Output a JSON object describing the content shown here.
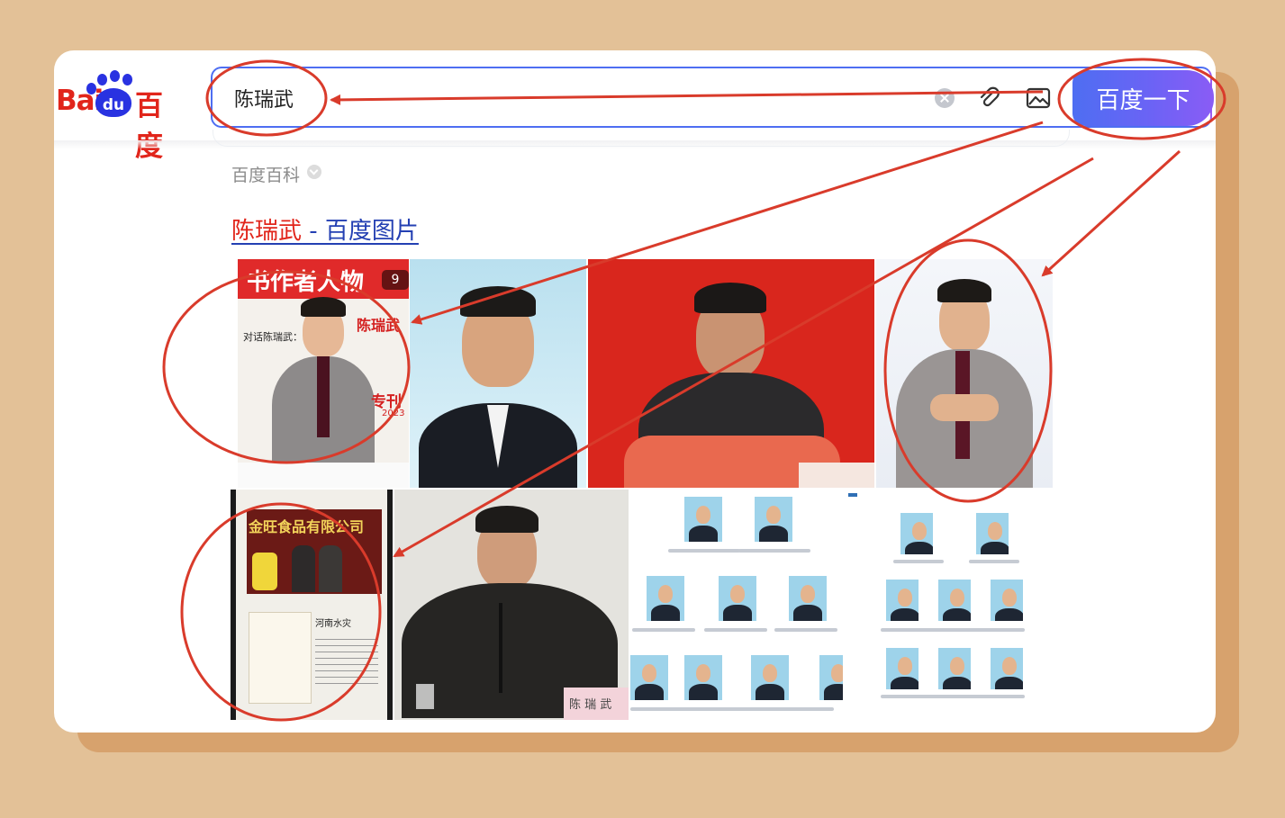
{
  "logo": {
    "bai": "Bai",
    "du": "du",
    "cn": "百度"
  },
  "search": {
    "query": "陈瑞武",
    "button_label": "百度一下"
  },
  "icons": {
    "clear": "clear-icon",
    "attach": "paperclip-icon",
    "image": "image-search-icon",
    "chevron": "chevron-down-icon"
  },
  "baike": {
    "label": "百度百科"
  },
  "result": {
    "title_keyword": "陈瑞武",
    "title_rest": " - 百度图片"
  },
  "images": [
    {
      "name": "magazine-cover-thumbnail",
      "count": "9",
      "masthead": "书作者人物",
      "person_name": "陈瑞武",
      "headline": "对话陈瑞武：",
      "special": "专刊",
      "year": "2023"
    },
    {
      "name": "official-portrait-thumbnail"
    },
    {
      "name": "conference-speaker-thumbnail"
    },
    {
      "name": "studio-portrait-thumbnail"
    },
    {
      "name": "donation-document-thumbnail",
      "banner": "金旺食品有限公司",
      "doc_title": "河南水灾"
    },
    {
      "name": "meeting-speaker-thumbnail",
      "nameplate": "陈 瑞 武"
    },
    {
      "name": "leadership-grid-thumbnail-1"
    },
    {
      "name": "leadership-grid-thumbnail-2"
    }
  ],
  "colors": {
    "brand_red": "#e1251b",
    "brand_blue": "#4e6ef2",
    "link_blue": "#2440b3",
    "annotation_red": "#d93b2b",
    "page_background": "#e3c197"
  }
}
